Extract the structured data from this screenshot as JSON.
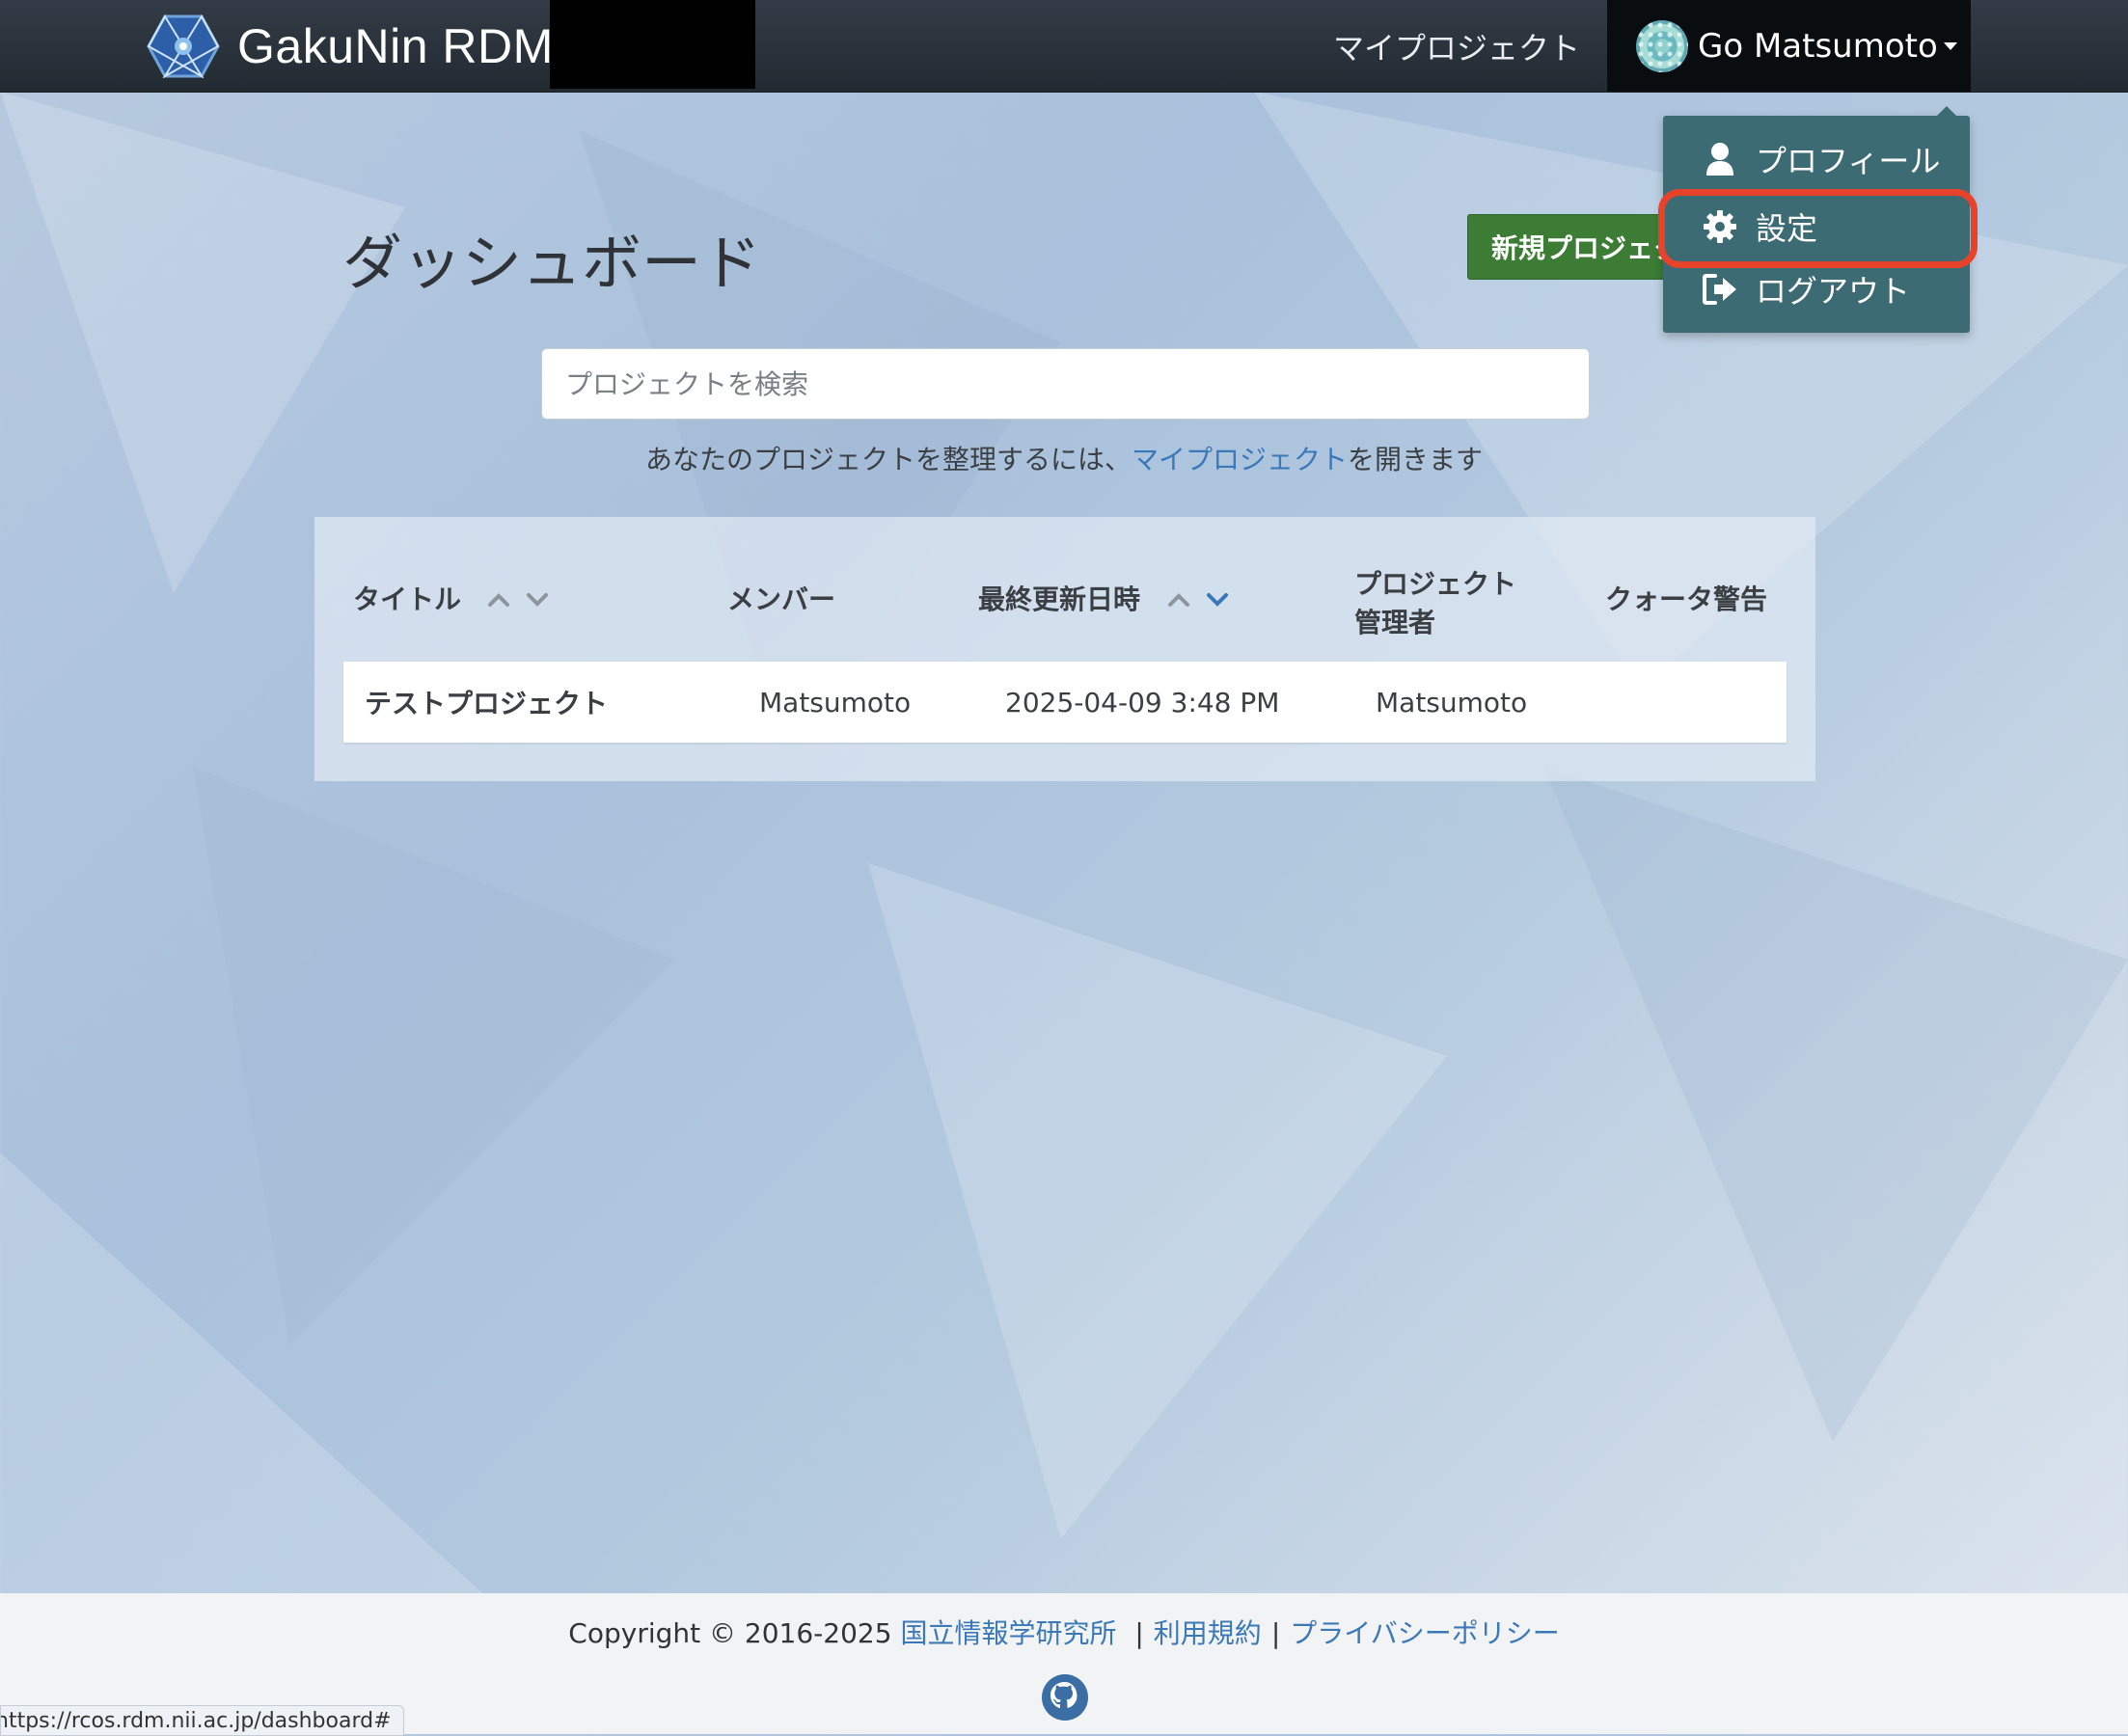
{
  "navbar": {
    "brand": "GakuNin RDM",
    "my_projects": "マイプロジェクト",
    "user_name": "Go Matsumoto"
  },
  "user_dropdown": {
    "items": [
      {
        "label": "プロフィール",
        "icon": "user-icon"
      },
      {
        "label": "設定",
        "icon": "gear-icon"
      },
      {
        "label": "ログアウト",
        "icon": "sign-out-icon"
      }
    ],
    "highlighted": "設定",
    "highlight_color": "#e8432a"
  },
  "dashboard": {
    "title": "ダッシュボード",
    "new_project_button": "新規プロジェクト作成",
    "search_placeholder": "プロジェクトを検索",
    "hint_before": "あなたのプロジェクトを整理するには、",
    "hint_link": "マイプロジェクト",
    "hint_after": "を開きます"
  },
  "table": {
    "headers": {
      "title": "タイトル",
      "members": "メンバー",
      "updated": "最終更新日時",
      "admin_line1": "プロジェクト",
      "admin_line2": "管理者",
      "quota": "クォータ警告"
    },
    "rows": [
      {
        "title": "テストプロジェクト",
        "members": "Matsumoto",
        "updated": "2025-04-09 3:48 PM",
        "admin": "Matsumoto",
        "quota": ""
      }
    ]
  },
  "footer": {
    "copyright": "Copyright © 2016-2025",
    "links": [
      "国立情報学研究所",
      "利用規約",
      "プライバシーポリシー"
    ],
    "separator": "|"
  },
  "status_bar_url": "https://rcos.rdm.nii.ac.jp/dashboard#",
  "colors": {
    "navbar": "#222a32",
    "dropdown": "#3d6b74",
    "primary_button": "#3c7c34",
    "link": "#3a78b8"
  }
}
